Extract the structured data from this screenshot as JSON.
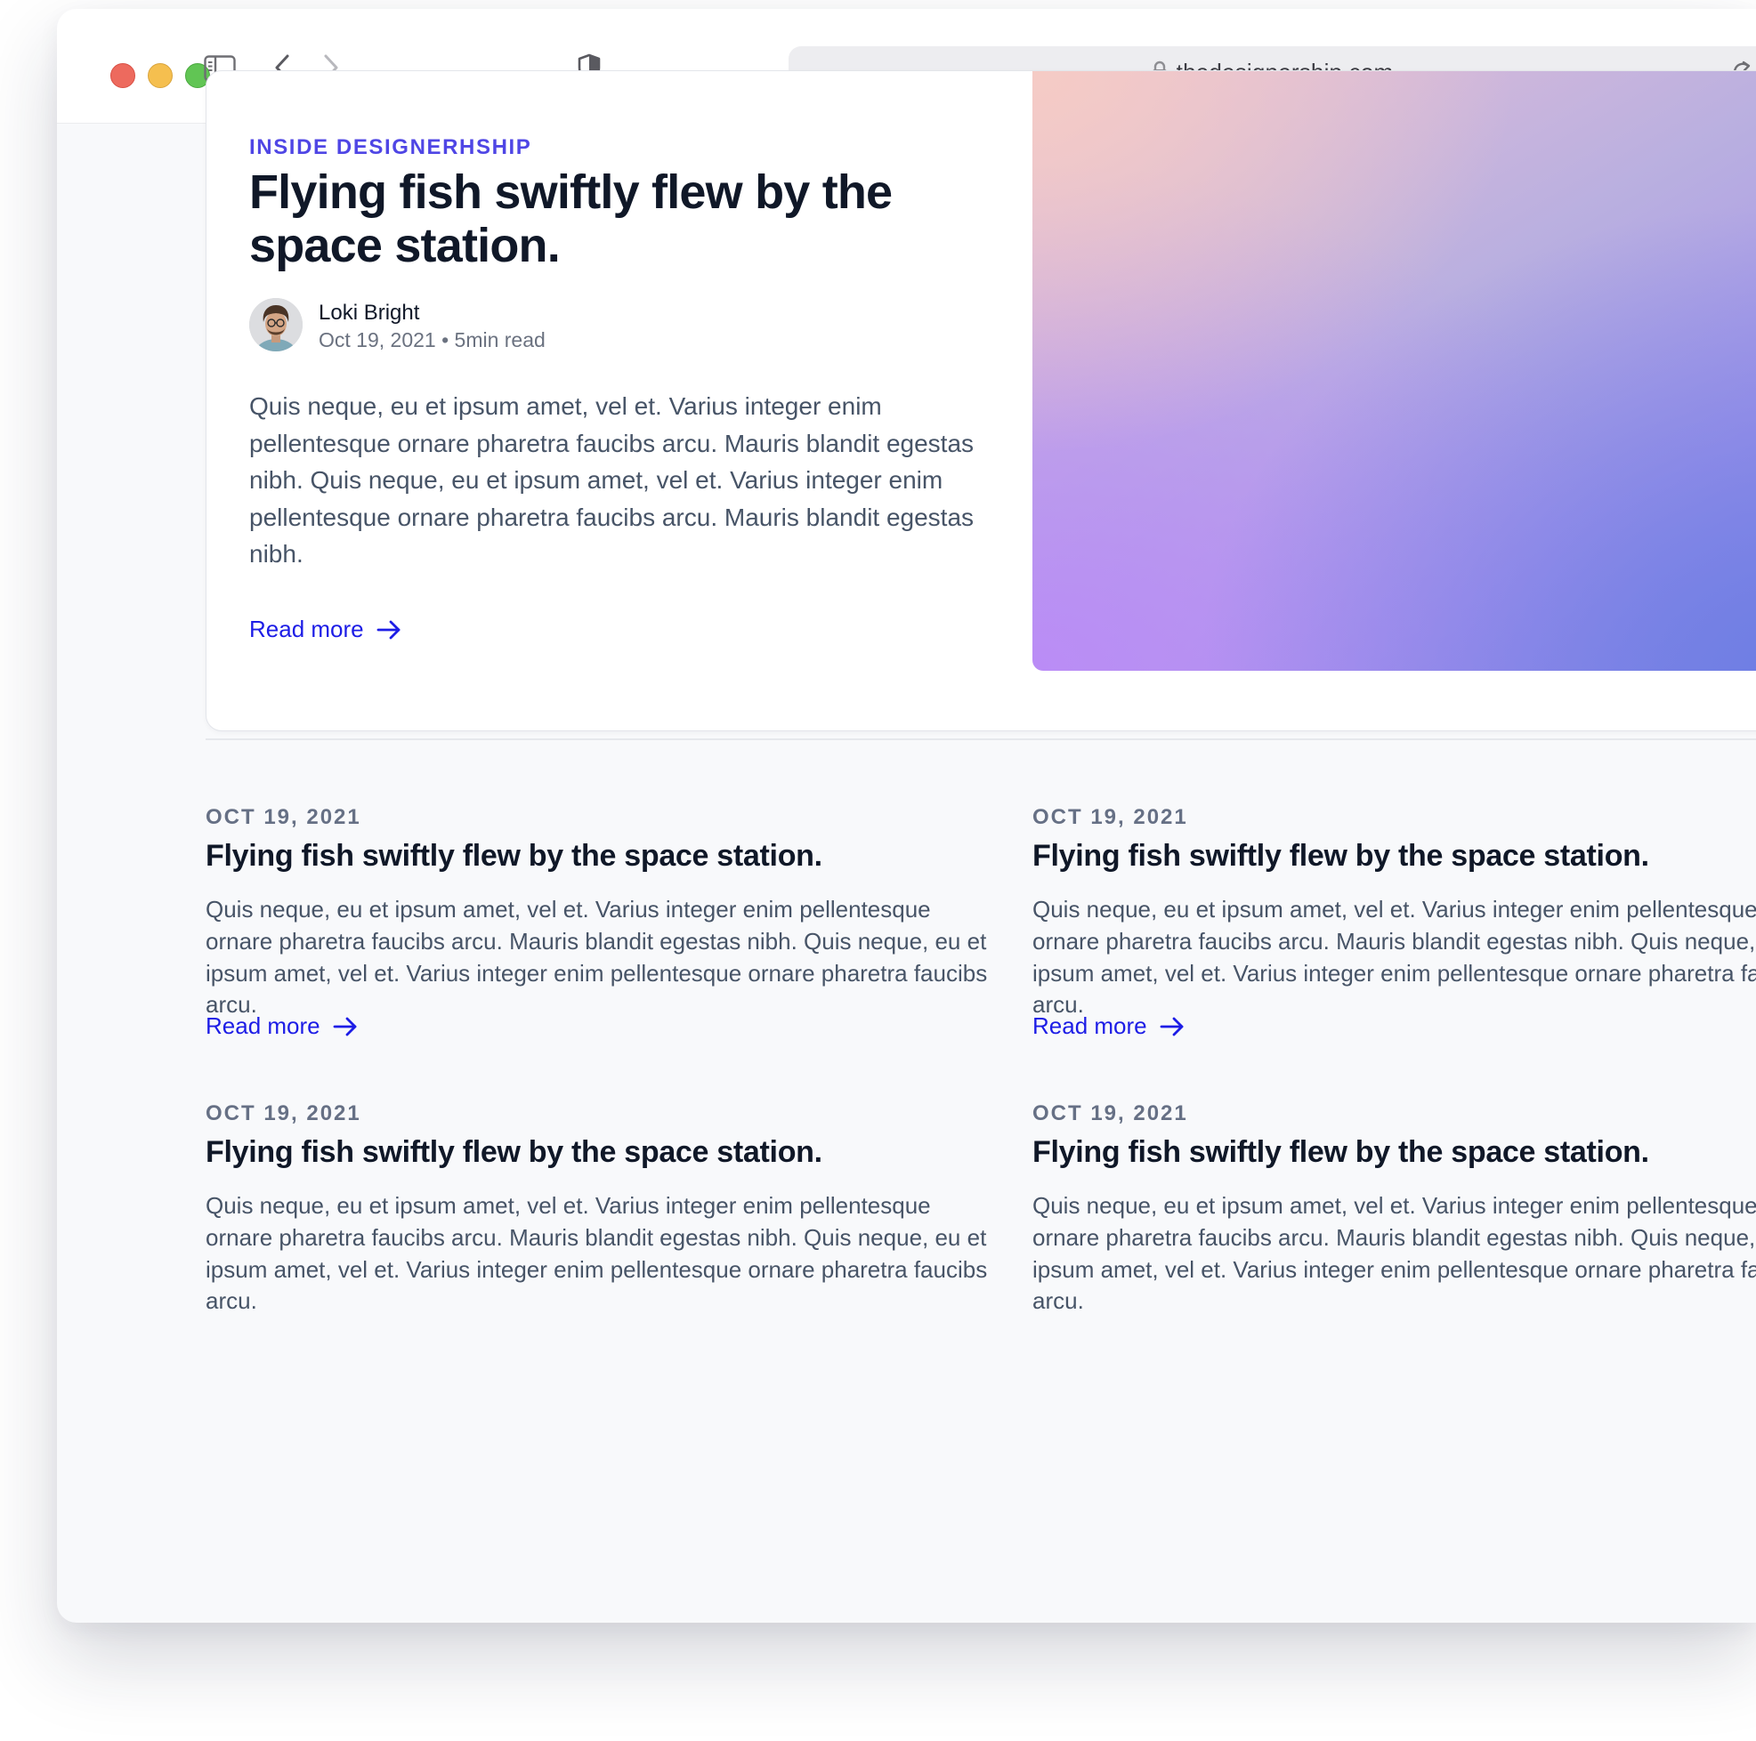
{
  "browser": {
    "url": "thedesignership.com"
  },
  "hero": {
    "eyebrow": "INSIDE DESIGNERHSHIP",
    "title": "Flying fish swiftly flew by the space station.",
    "author_name": "Loki Bright",
    "author_meta": "Oct 19, 2021 • 5min read",
    "excerpt": "Quis neque, eu et ipsum amet, vel et. Varius integer enim pellentesque ornare pharetra faucibs arcu. Mauris blandit egestas nibh. Quis neque, eu et ipsum amet, vel et. Varius integer enim pellentesque ornare pharetra faucibs arcu. Mauris blandit egestas nibh.",
    "read_more": "Read more"
  },
  "posts": [
    {
      "date": "OCT 19, 2021",
      "title": "Flying fish swiftly flew by the space station.",
      "excerpt": "Quis neque, eu et ipsum amet, vel et. Varius integer enim pellentesque ornare pharetra faucibs arcu. Mauris blandit egestas nibh. Quis neque, eu et ipsum amet, vel et. Varius integer enim pellentesque ornare pharetra faucibs arcu.",
      "read_more": "Read more"
    },
    {
      "date": "OCT 19, 2021",
      "title": "Flying fish swiftly flew by the space station.",
      "excerpt": "Quis neque, eu et ipsum amet, vel et. Varius integer enim pellentesque ornare pharetra faucibs arcu. Mauris blandit egestas nibh. Quis neque, eu et ipsum amet, vel et. Varius integer enim pellentesque ornare pharetra faucibs arcu.",
      "read_more": "Read more"
    },
    {
      "date": "OCT 19, 2021",
      "title": "Flying fish swiftly flew by the space station.",
      "excerpt": "Quis neque, eu et ipsum amet, vel et. Varius integer enim pellentesque ornare pharetra faucibs arcu. Mauris blandit egestas nibh. Quis neque, eu et ipsum amet, vel et. Varius integer enim pellentesque ornare pharetra faucibs arcu."
    },
    {
      "date": "OCT 19, 2021",
      "title": "Flying fish swiftly flew by the space station.",
      "excerpt": "Quis neque, eu et ipsum amet, vel et. Varius integer enim pellentesque ornare pharetra faucibs arcu. Mauris blandit egestas nibh. Quis neque, eu et ipsum amet, vel et. Varius integer enim pellentesque ornare pharetra faucibs arcu."
    }
  ],
  "colors": {
    "accent": "#4f46e5",
    "link": "#1d1de6",
    "heading": "#101828",
    "body": "#475467",
    "muted": "#667085"
  },
  "icons": {
    "sidebar": "sidebar-icon",
    "back": "chevron-left-icon",
    "forward": "chevron-right-icon",
    "privacy": "shield-icon",
    "lock": "lock-icon",
    "reload": "reload-icon",
    "arrow": "arrow-right-icon"
  }
}
